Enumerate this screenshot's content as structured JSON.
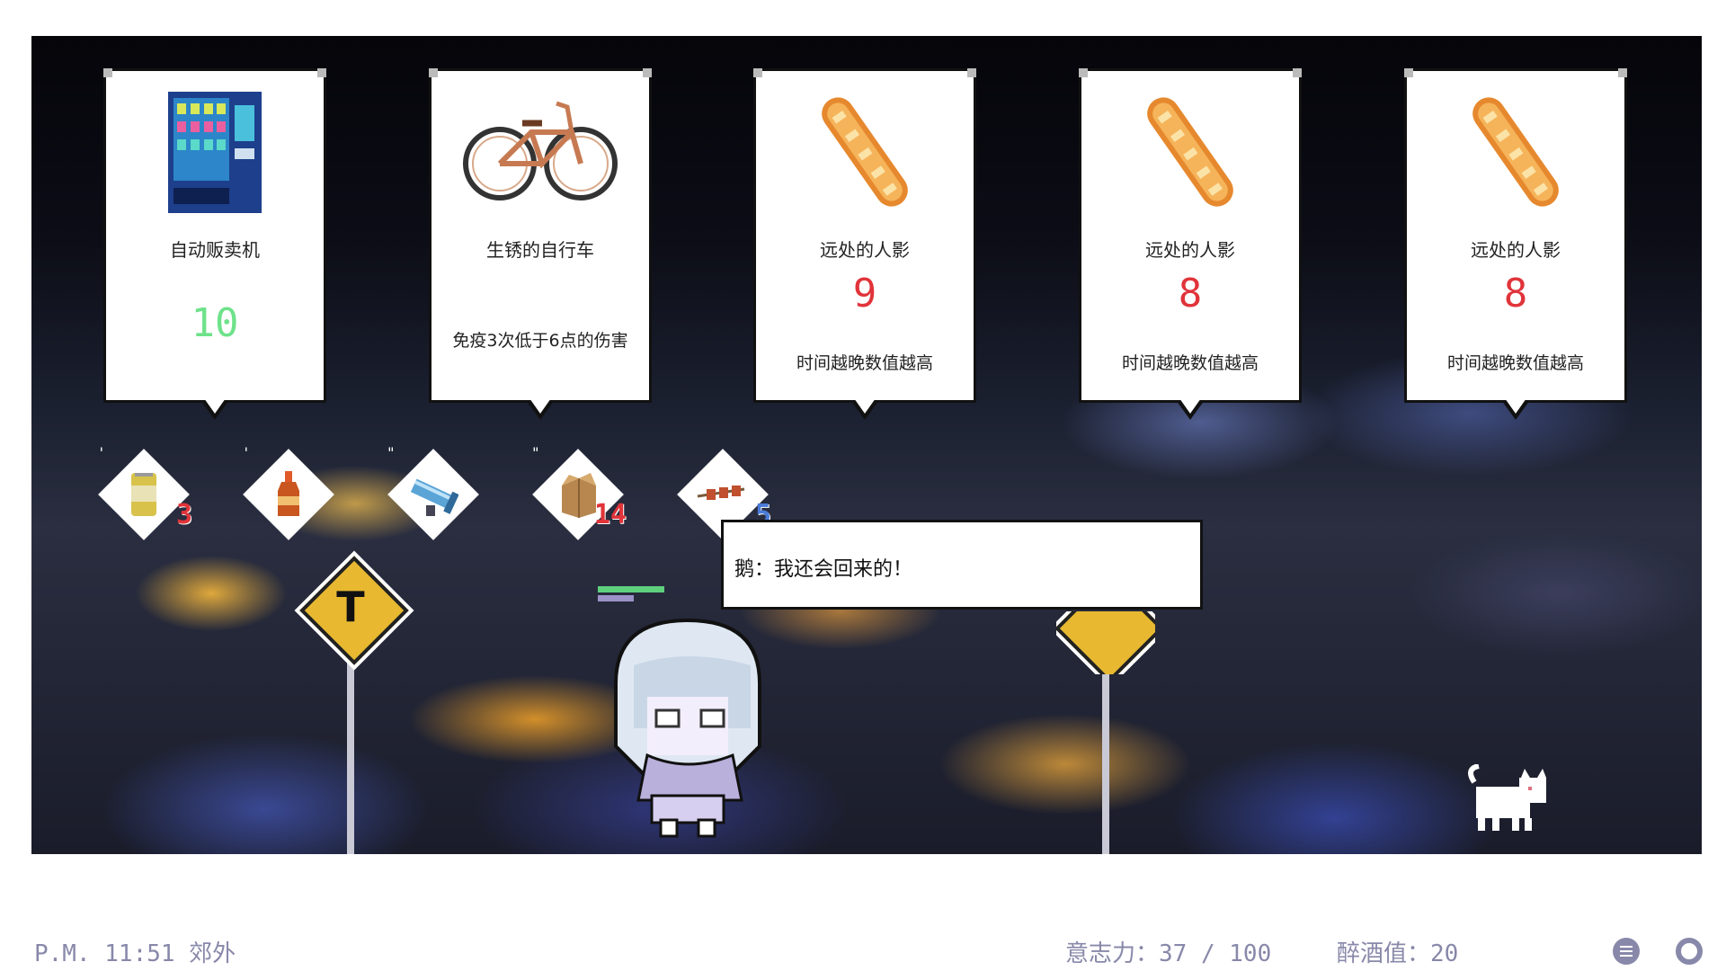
{
  "cards": [
    {
      "name": "自动贩卖机",
      "value": "10",
      "value_color": "#6ee28a",
      "desc": "",
      "icon": "vending-machine-icon"
    },
    {
      "name": "生锈的自行车",
      "value": "",
      "value_color": "",
      "desc": "免疫3次低于6点的伤害",
      "icon": "bicycle-icon"
    },
    {
      "name": "远处的人影",
      "value": "9",
      "value_color": "#e0343a",
      "desc": "时间越晚数值越高",
      "icon": "baguette-icon"
    },
    {
      "name": "远处的人影",
      "value": "8",
      "value_color": "#e0343a",
      "desc": "时间越晚数值越高",
      "icon": "baguette-icon"
    },
    {
      "name": "远处的人影",
      "value": "8",
      "value_color": "#e0343a",
      "desc": "时间越晚数值越高",
      "icon": "baguette-icon"
    }
  ],
  "inventory": [
    {
      "icon": "beer-can-icon",
      "tick": "'",
      "count": "3"
    },
    {
      "icon": "soda-bottle-icon",
      "tick": "'",
      "count": ""
    },
    {
      "icon": "cannon-icon",
      "tick": "\"",
      "count": ""
    },
    {
      "icon": "cardboard-box-icon",
      "tick": "\"",
      "count": "14"
    },
    {
      "icon": "skewer-icon",
      "tick": "",
      "count": "5"
    }
  ],
  "sign_left": {
    "letter": "T"
  },
  "dialog": {
    "text": "鹅：我还会回来的！"
  },
  "status": {
    "time_location": "P.M. 11:51 郊外",
    "willpower": "意志力：37 / 100",
    "drunk": "醉酒值：20"
  },
  "colors": {
    "accent": "#8888aa",
    "danger": "#e0343a",
    "good": "#6ee28a"
  }
}
